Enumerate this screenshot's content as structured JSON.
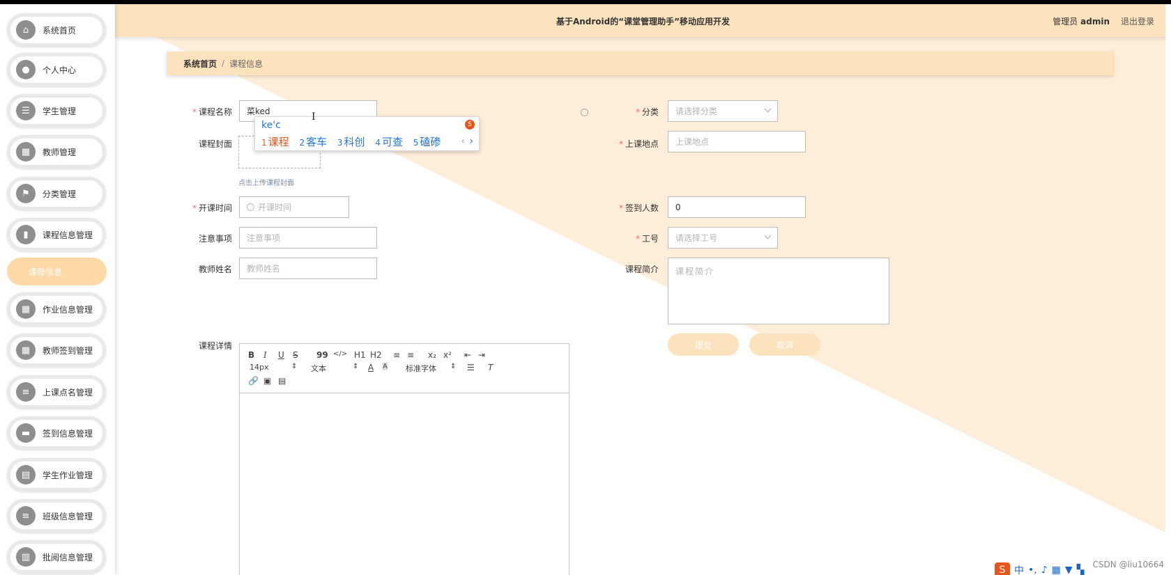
{
  "header": {
    "title": "基于Android的“课堂管理助手”移动应用开发",
    "user_role": "管理员",
    "user_name": "admin",
    "logout": "退出登录"
  },
  "sidebar": {
    "items": [
      {
        "label": "系统首页",
        "icon": "home-icon"
      },
      {
        "label": "个人中心",
        "icon": "user-icon"
      },
      {
        "label": "学生管理",
        "icon": "sliders-icon"
      },
      {
        "label": "教师管理",
        "icon": "grid-icon"
      },
      {
        "label": "分类管理",
        "icon": "flag-icon"
      },
      {
        "label": "课程信息管理",
        "icon": "bar-chart-icon"
      },
      {
        "label": "作业信息管理",
        "icon": "grid-icon"
      },
      {
        "label": "教师签到管理",
        "icon": "grid-icon"
      },
      {
        "label": "上课点名管理",
        "icon": "list-icon"
      },
      {
        "label": "签到信息管理",
        "icon": "chat-icon"
      },
      {
        "label": "学生作业管理",
        "icon": "clipboard-icon"
      },
      {
        "label": "班级信息管理",
        "icon": "list-icon"
      },
      {
        "label": "批阅信息管理",
        "icon": "building-icon"
      }
    ],
    "active_sub": "课程信息"
  },
  "breadcrumb": {
    "home": "系统首页",
    "separator": "/",
    "current": "课程信息"
  },
  "form": {
    "course_name": {
      "label": "课程名称",
      "value": "菜ked"
    },
    "category": {
      "label": "分类",
      "placeholder": "请选择分类"
    },
    "cover": {
      "label": "课程封面",
      "hint": "点击上传课程封面"
    },
    "location": {
      "label": "上课地点",
      "placeholder": "上课地点"
    },
    "start_time": {
      "label": "开课时间",
      "placeholder": "开课时间"
    },
    "signin_count": {
      "label": "签到人数",
      "value": "0"
    },
    "notes": {
      "label": "注意事项",
      "placeholder": "注意事项"
    },
    "job_no": {
      "label": "工号",
      "placeholder": "请选择工号"
    },
    "teacher_name": {
      "label": "教师姓名",
      "placeholder": "教师姓名"
    },
    "intro": {
      "label": "课程简介",
      "placeholder": "课程简介"
    },
    "details": {
      "label": "课程详情"
    },
    "submit": "提交",
    "cancel": "取消"
  },
  "editor": {
    "row1": [
      "B",
      "I",
      "U",
      "S",
      "99",
      "</>",
      "H1",
      "H2",
      "≡",
      "≡",
      "x₂",
      "x²",
      "⇤",
      "⇥"
    ],
    "font_size": "14px",
    "text_style": "文本",
    "font_family": "标准字体"
  },
  "ime": {
    "pinyin": "ke'c",
    "candidates": [
      {
        "n": "1",
        "t": "课程"
      },
      {
        "n": "2",
        "t": "客车"
      },
      {
        "n": "3",
        "t": "科创"
      },
      {
        "n": "4",
        "t": "可查"
      },
      {
        "n": "5",
        "t": "磕碜"
      }
    ]
  },
  "watermark": "CSDN @liu10664"
}
